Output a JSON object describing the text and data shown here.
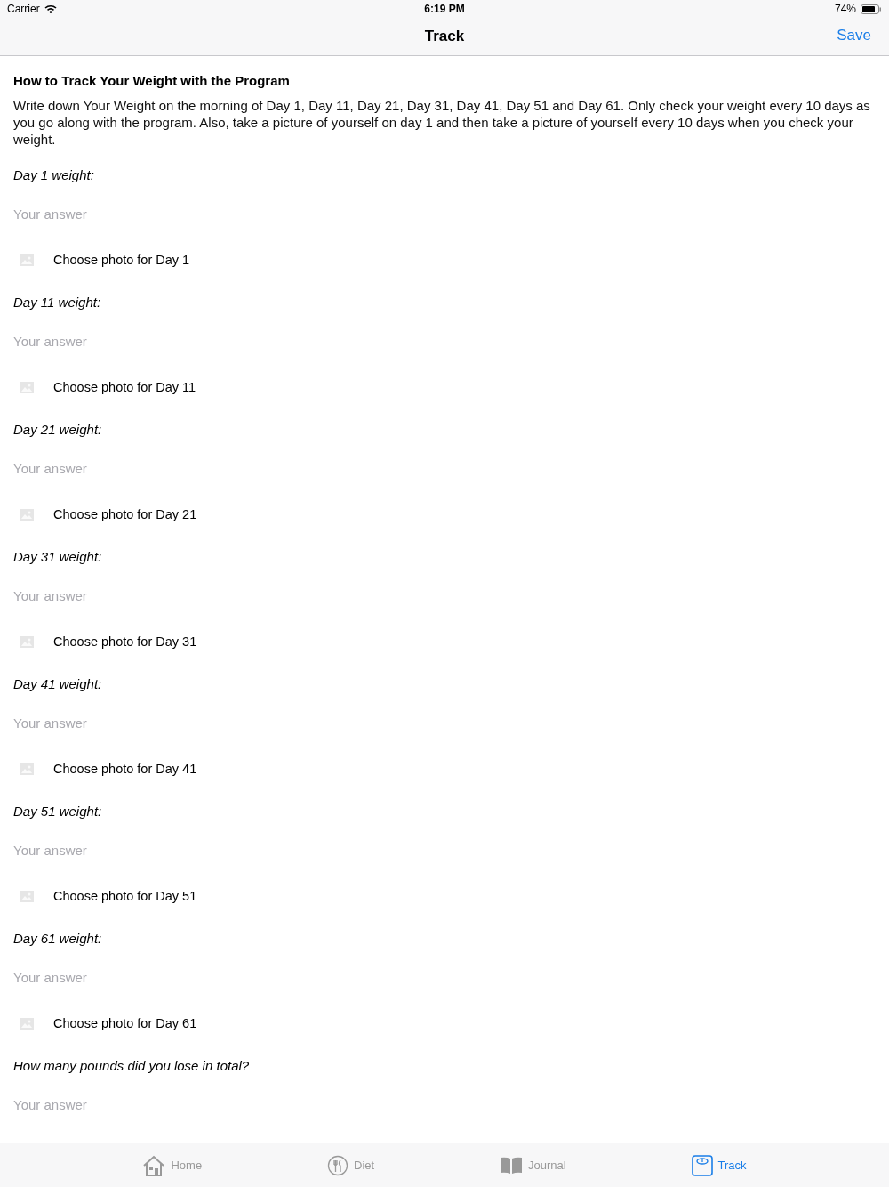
{
  "status_bar": {
    "carrier": "Carrier",
    "time": "6:19 PM",
    "battery": "74%"
  },
  "nav": {
    "title": "Track",
    "action": "Save"
  },
  "intro": {
    "title": "How to Track Your Weight with the Program",
    "text": "Write down Your Weight on the morning of Day 1, Day 11, Day 21, Day 31, Day 41, Day 51 and Day 61.  Only check your weight every 10 days as you go along with the program. Also, take a picture of yourself on day 1 and then take a picture of yourself every 10 days when you check your weight."
  },
  "questions": [
    {
      "label": "Day 1 weight:",
      "placeholder": "Your answer",
      "photo_label": "Choose photo for Day 1"
    },
    {
      "label": "Day 11 weight:",
      "placeholder": "Your answer",
      "photo_label": "Choose photo for Day 11"
    },
    {
      "label": "Day 21 weight:",
      "placeholder": "Your answer",
      "photo_label": "Choose photo for Day 21"
    },
    {
      "label": "Day 31 weight:",
      "placeholder": "Your answer",
      "photo_label": "Choose photo for Day 31"
    },
    {
      "label": "Day 41 weight:",
      "placeholder": "Your answer",
      "photo_label": "Choose photo for Day 41"
    },
    {
      "label": "Day 51 weight:",
      "placeholder": "Your answer",
      "photo_label": "Choose photo for Day 51"
    },
    {
      "label": "Day 61 weight:",
      "placeholder": "Your answer",
      "photo_label": "Choose photo for Day 61"
    },
    {
      "label": "How many pounds did you lose in total?",
      "placeholder": "Your answer"
    }
  ],
  "tabs": [
    {
      "kind": "home",
      "label": "Home",
      "selected": false
    },
    {
      "kind": "diet",
      "label": "Diet",
      "selected": false
    },
    {
      "kind": "journal",
      "label": "Journal",
      "selected": false
    },
    {
      "kind": "track",
      "label": "Track",
      "selected": true
    }
  ]
}
